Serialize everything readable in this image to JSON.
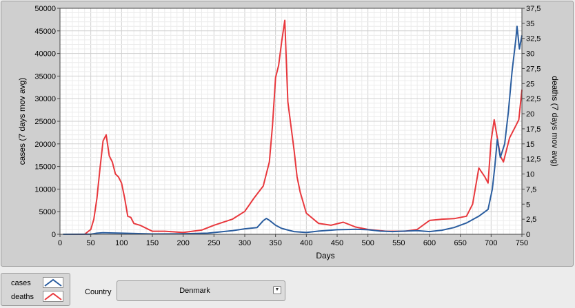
{
  "legend": {
    "items": [
      {
        "label": "cases",
        "color": "#2a5d9f"
      },
      {
        "label": "deaths",
        "color": "#e8383d"
      }
    ]
  },
  "country": {
    "label": "Country",
    "selected": "Denmark",
    "dropdown_icon": "chevron-down-icon"
  },
  "chart_data": {
    "type": "line",
    "xlabel": "Days",
    "ylabel_left": "cases  (7 days mov avg)",
    "ylabel_right": "deaths  (7 days mov avg)",
    "xlim": [
      0,
      750
    ],
    "ylim_left": [
      0,
      50000
    ],
    "ylim_right": [
      0,
      37.5
    ],
    "x_ticks": [
      "0",
      "50",
      "100",
      "150",
      "200",
      "250",
      "300",
      "350",
      "400",
      "450",
      "500",
      "550",
      "600",
      "650",
      "700",
      "750"
    ],
    "y_left_ticks": [
      "0",
      "5000",
      "10000",
      "15000",
      "20000",
      "25000",
      "30000",
      "35000",
      "40000",
      "45000",
      "50000"
    ],
    "y_right_ticks": [
      "0",
      "2,5",
      "5",
      "7,5",
      "10",
      "12,5",
      "15",
      "17,5",
      "20",
      "22,5",
      "25",
      "27,5",
      "30",
      "32,5",
      "35",
      "37,5"
    ],
    "grid": true,
    "series": [
      {
        "name": "cases",
        "axis": "left",
        "color": "#2a5d9f",
        "points": [
          [
            5,
            0
          ],
          [
            50,
            20
          ],
          [
            60,
            250
          ],
          [
            70,
            350
          ],
          [
            80,
            300
          ],
          [
            100,
            250
          ],
          [
            150,
            80
          ],
          [
            200,
            100
          ],
          [
            240,
            250
          ],
          [
            280,
            800
          ],
          [
            300,
            1200
          ],
          [
            320,
            1500
          ],
          [
            330,
            3000
          ],
          [
            335,
            3500
          ],
          [
            340,
            3100
          ],
          [
            350,
            2000
          ],
          [
            360,
            1300
          ],
          [
            380,
            600
          ],
          [
            400,
            400
          ],
          [
            420,
            700
          ],
          [
            450,
            1000
          ],
          [
            480,
            1100
          ],
          [
            500,
            1000
          ],
          [
            520,
            700
          ],
          [
            540,
            600
          ],
          [
            560,
            700
          ],
          [
            580,
            800
          ],
          [
            600,
            600
          ],
          [
            620,
            900
          ],
          [
            640,
            1500
          ],
          [
            660,
            2500
          ],
          [
            680,
            4000
          ],
          [
            695,
            5500
          ],
          [
            702,
            10000
          ],
          [
            706,
            15000
          ],
          [
            710,
            21000
          ],
          [
            715,
            17000
          ],
          [
            722,
            20000
          ],
          [
            728,
            27000
          ],
          [
            734,
            36000
          ],
          [
            740,
            43000
          ],
          [
            742,
            46000
          ],
          [
            746,
            41000
          ],
          [
            750,
            44000
          ]
        ]
      },
      {
        "name": "deaths",
        "axis": "right",
        "color": "#e8383d",
        "points": [
          [
            5,
            0
          ],
          [
            40,
            0
          ],
          [
            50,
            0.8
          ],
          [
            55,
            2.5
          ],
          [
            60,
            6
          ],
          [
            65,
            11
          ],
          [
            70,
            15.5
          ],
          [
            75,
            16.5
          ],
          [
            80,
            13
          ],
          [
            85,
            12
          ],
          [
            90,
            10
          ],
          [
            95,
            9.5
          ],
          [
            100,
            8.5
          ],
          [
            105,
            6
          ],
          [
            110,
            3
          ],
          [
            115,
            2.8
          ],
          [
            120,
            1.8
          ],
          [
            130,
            1.5
          ],
          [
            140,
            1
          ],
          [
            150,
            0.5
          ],
          [
            170,
            0.5
          ],
          [
            200,
            0.3
          ],
          [
            230,
            0.7
          ],
          [
            250,
            1.5
          ],
          [
            280,
            2.5
          ],
          [
            300,
            3.8
          ],
          [
            315,
            6
          ],
          [
            330,
            8
          ],
          [
            340,
            12
          ],
          [
            345,
            18
          ],
          [
            350,
            26
          ],
          [
            355,
            28
          ],
          [
            360,
            32
          ],
          [
            365,
            35.5
          ],
          [
            370,
            22
          ],
          [
            375,
            18
          ],
          [
            380,
            14
          ],
          [
            385,
            9.5
          ],
          [
            390,
            7
          ],
          [
            400,
            3.5
          ],
          [
            420,
            1.8
          ],
          [
            440,
            1.5
          ],
          [
            460,
            2
          ],
          [
            480,
            1.2
          ],
          [
            500,
            0.8
          ],
          [
            530,
            0.5
          ],
          [
            560,
            0.5
          ],
          [
            580,
            0.8
          ],
          [
            600,
            2.3
          ],
          [
            620,
            2.5
          ],
          [
            640,
            2.6
          ],
          [
            660,
            3
          ],
          [
            670,
            5
          ],
          [
            680,
            11
          ],
          [
            690,
            9.5
          ],
          [
            695,
            8.5
          ],
          [
            700,
            15.5
          ],
          [
            705,
            19
          ],
          [
            710,
            16
          ],
          [
            715,
            13
          ],
          [
            720,
            12
          ],
          [
            730,
            16
          ],
          [
            740,
            18
          ],
          [
            745,
            19
          ],
          [
            750,
            24
          ]
        ]
      }
    ]
  }
}
